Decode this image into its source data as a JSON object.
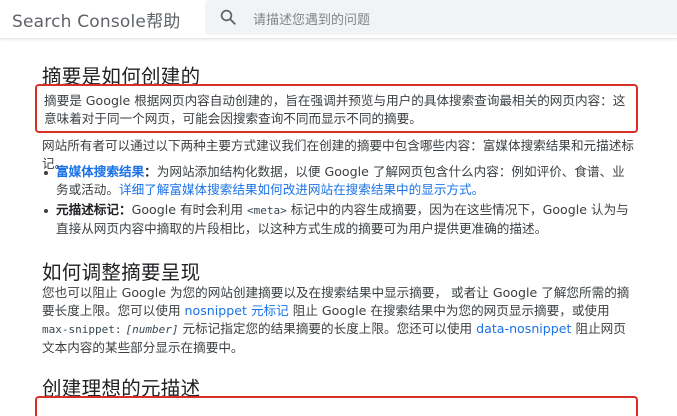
{
  "header": {
    "brand": "Search Console帮助",
    "search_placeholder": "请描述您遇到的问题"
  },
  "section1": {
    "title": "摘要是如何创建的",
    "highlight": "摘要是 Google 根据网页内容自动创建的，旨在强调并预览与用户的具体搜索查询最相关的网页内容：这意味着对于同一个网页，可能会因搜索查询不同而显示不同的摘要。",
    "intro": "网站所有者可以通过以下两种主要方式建议我们在创建的摘要中包含哪些内容：富媒体搜索结果和元描述标记。",
    "bullet1": {
      "term": "富媒体搜索结果",
      "colon": "：",
      "text": "为网站添加结构化数据，以便 Google 了解网页包含什么内容：例如评价、食谱、业务或活动。",
      "link": "详细了解富媒体搜索结果如何改进网站在搜索结果中的显示方式。"
    },
    "bullet2": {
      "term": "元描述标记",
      "colon": "：",
      "text_a": "Google 有时会利用 ",
      "code": "<meta>",
      "text_b": " 标记中的内容生成摘要，因为在这些情况下，Google 认为与直接从网页内容中摘取的片段相比，以这种方式生成的摘要可为用户提供更准确的描述。"
    }
  },
  "section2": {
    "title": "如何调整摘要呈现",
    "p_a": "您也可以阻止 Google 为您的网站创建摘要以及在搜索结果中显示摘要， 或者让 Google 了解您所需的摘要长度上限。您可以使用 ",
    "link1": "nosnippet 元标记",
    "p_b": " 阻止 Google 在搜索结果中为您的网页显示摘要，或使用 ",
    "code1": "max-snippet:",
    "code2": "[number]",
    "p_c": " 元标记指定您的结果摘要的长度上限。您还可以使用 ",
    "link2": "data-nosnippet",
    "p_d": " 阻止网页 文本内容的某些部分显示在摘要中。"
  },
  "section3": {
    "title": "创建理想的元描述"
  },
  "colors": {
    "accent": "#1a73e8",
    "highlight_border": "#d93025"
  }
}
